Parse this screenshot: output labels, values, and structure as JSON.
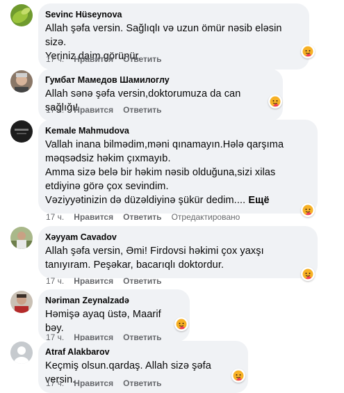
{
  "actions": {
    "like": "Нравится",
    "reply": "Ответить",
    "edited": "Отредактировано"
  },
  "reaction_icon": "care-emoji-icon",
  "comments": [
    {
      "author": "Sevinc Hüseynova",
      "text": "Allah şəfa versin. Sağlıqlı və uzun ömür nəsib eləsin sizə.\nYeriniz daim görünür.",
      "time": "17 ч.",
      "avatar": "leaf-photo"
    },
    {
      "author": "Гумбат Мамедов Шамилоглу",
      "text": "Allah sənə şəfa versin,doktorumuza da can sağlığı!",
      "time": "17 ч.",
      "avatar": "man-photo"
    },
    {
      "author": "Kemale Mahmudova",
      "text": "Vallah inana bilmədim,məni qınamayın.Hələ qarşıma\nməqsədsiz həkim çıxmayıb.\nAmma sizə belə bir həkim nəsib olduğuna,sizi xilas\netdiyinə görə çox sevindim.\nVəziyyətinizin də düzəldiyinə şükür dedim....",
      "more": "Ещё",
      "time": "17 ч.",
      "edited": true,
      "avatar": "dark-photo"
    },
    {
      "author": "Xəyyam Cavadov",
      "text": "Allah şəfa versin, Əmi! Firdovsi həkimi çox yaxşı\ntanıyıram. Peşəkar, bacarıqlı doktordur.",
      "time": "17 ч.",
      "avatar": "outdoor-photo"
    },
    {
      "author": "Nəriman Zeynalzadə",
      "text": "Həmişə ayaq üstə, Maarif bəy.",
      "time": "17 ч.",
      "avatar": "man-red-photo"
    },
    {
      "author": "Atraf Alakbarov",
      "text": "Keçmiş olsun.qardaş. Allah sizə şəfa versin.",
      "time": "17 ч.",
      "avatar": "default-avatar"
    }
  ]
}
